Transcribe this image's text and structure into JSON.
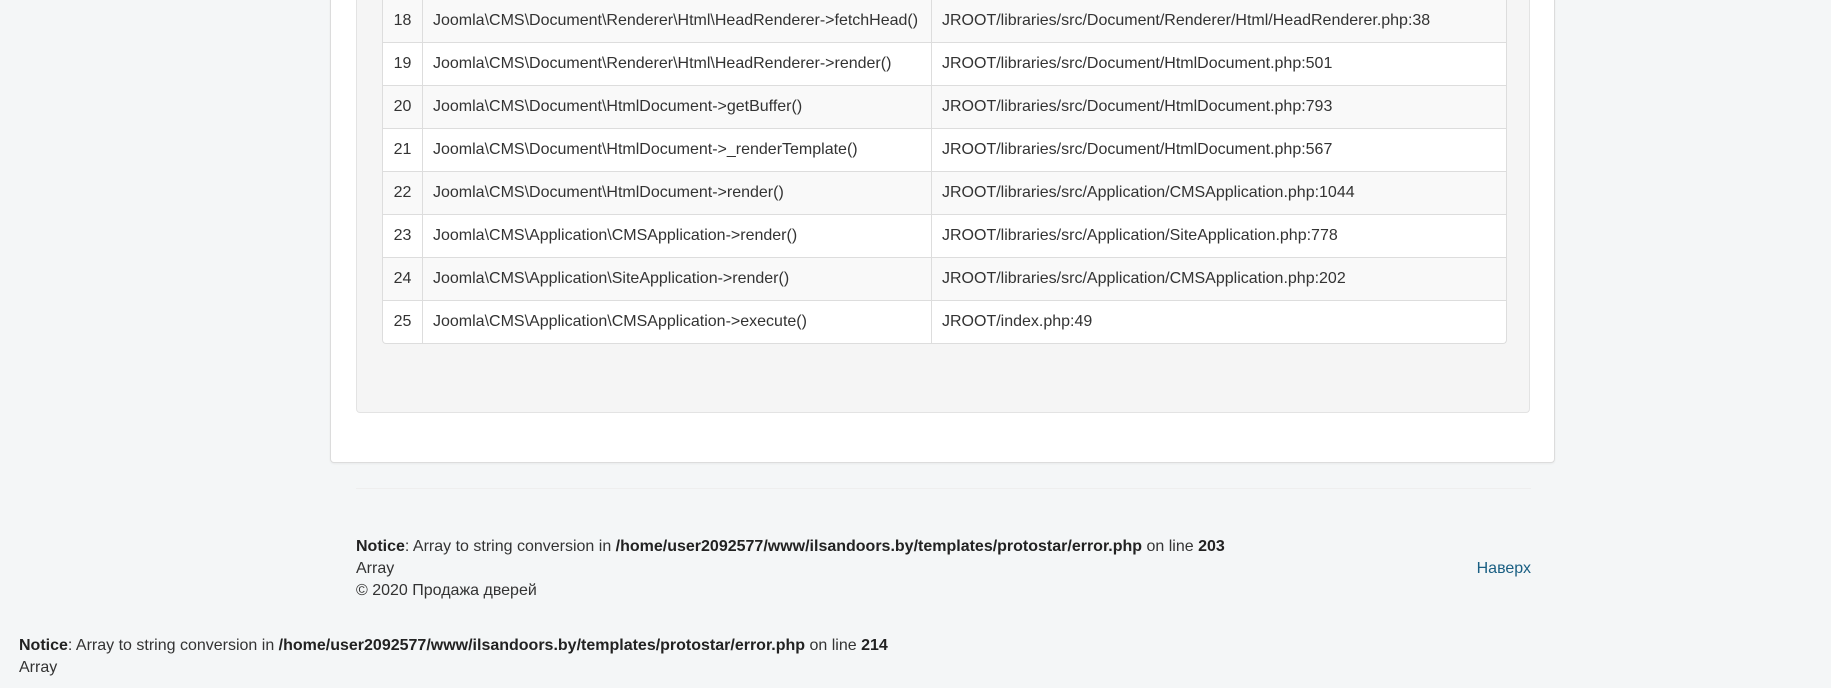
{
  "trace": {
    "rows": [
      {
        "num": "18",
        "fn": "Joomla\\CMS\\Document\\Renderer\\Html\\HeadRenderer->fetchHead()",
        "loc": "JROOT/libraries/src/Document/Renderer/Html/HeadRenderer.php:38"
      },
      {
        "num": "19",
        "fn": "Joomla\\CMS\\Document\\Renderer\\Html\\HeadRenderer->render()",
        "loc": "JROOT/libraries/src/Document/HtmlDocument.php:501"
      },
      {
        "num": "20",
        "fn": "Joomla\\CMS\\Document\\HtmlDocument->getBuffer()",
        "loc": "JROOT/libraries/src/Document/HtmlDocument.php:793"
      },
      {
        "num": "21",
        "fn": "Joomla\\CMS\\Document\\HtmlDocument->_renderTemplate()",
        "loc": "JROOT/libraries/src/Document/HtmlDocument.php:567"
      },
      {
        "num": "22",
        "fn": "Joomla\\CMS\\Document\\HtmlDocument->render()",
        "loc": "JROOT/libraries/src/Application/CMSApplication.php:1044"
      },
      {
        "num": "23",
        "fn": "Joomla\\CMS\\Application\\CMSApplication->render()",
        "loc": "JROOT/libraries/src/Application/SiteApplication.php:778"
      },
      {
        "num": "24",
        "fn": "Joomla\\CMS\\Application\\SiteApplication->render()",
        "loc": "JROOT/libraries/src/Application/CMSApplication.php:202"
      },
      {
        "num": "25",
        "fn": "Joomla\\CMS\\Application\\CMSApplication->execute()",
        "loc": "JROOT/index.php:49"
      }
    ]
  },
  "footer": {
    "notice_label": "Notice",
    "notice_text": ": Array to string conversion in ",
    "notice_path": "/home/user2092577/www/ilsandoors.by/templates/protostar/error.php",
    "notice_on_line": " on line ",
    "notice_line": "203",
    "array_text": "Array",
    "copyright": "© 2020 Продажа дверей",
    "back_to_top": "Наверх"
  },
  "notice2": {
    "label": "Notice",
    "text": ": Array to string conversion in ",
    "path": "/home/user2092577/www/ilsandoors.by/templates/protostar/error.php",
    "on_line": " on line ",
    "line": "214",
    "array_text": "Array"
  }
}
